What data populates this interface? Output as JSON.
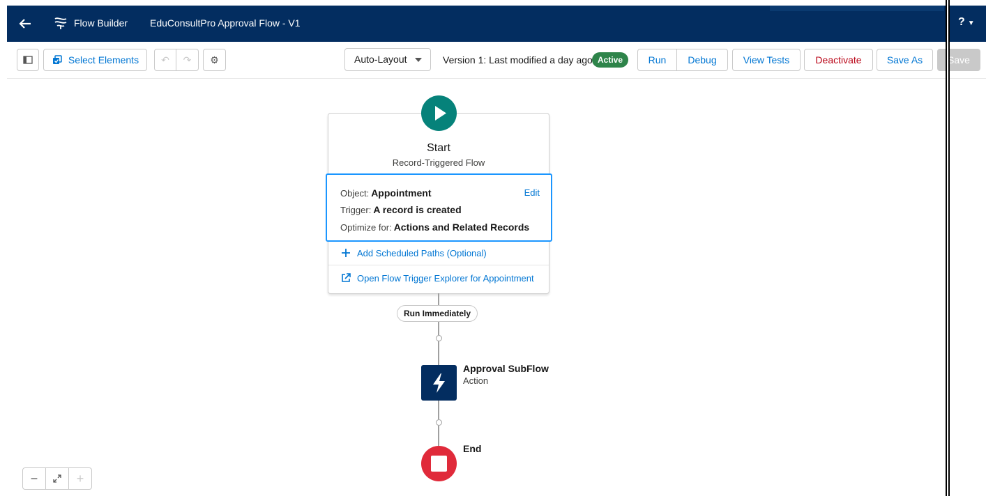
{
  "header": {
    "app_name": "Flow Builder",
    "flow_title": "EduConsultPro Approval Flow - V1",
    "help_label": "?"
  },
  "toolbar": {
    "select_elements_label": "Select Elements",
    "layout_mode": "Auto-Layout",
    "version_text": "Version 1: Last modified a day ago",
    "status_badge": "Active",
    "run_label": "Run",
    "debug_label": "Debug",
    "view_tests_label": "View Tests",
    "deactivate_label": "Deactivate",
    "save_as_label": "Save As",
    "save_label": "Save"
  },
  "start_node": {
    "title": "Start",
    "subtitle": "Record-Triggered Flow",
    "object_label": "Object:",
    "object_value": "Appointment",
    "trigger_label": "Trigger:",
    "trigger_value": "A record is created",
    "optimize_label": "Optimize for:",
    "optimize_value": "Actions and Related Records",
    "edit_label": "Edit",
    "scheduled_paths_link": "Add Scheduled Paths (Optional)",
    "trigger_explorer_link": "Open Flow Trigger Explorer for Appointment"
  },
  "path_label": "Run Immediately",
  "action_node": {
    "title": "Approval SubFlow",
    "type": "Action"
  },
  "end_node": {
    "title": "End"
  },
  "colors": {
    "header_bg": "#032d60",
    "start_green": "#06827a",
    "active_green": "#2e844a",
    "action_navy": "#032d60",
    "end_red": "#e02a3a",
    "link_blue": "#0176d3",
    "selection_blue": "#1b96ff"
  }
}
